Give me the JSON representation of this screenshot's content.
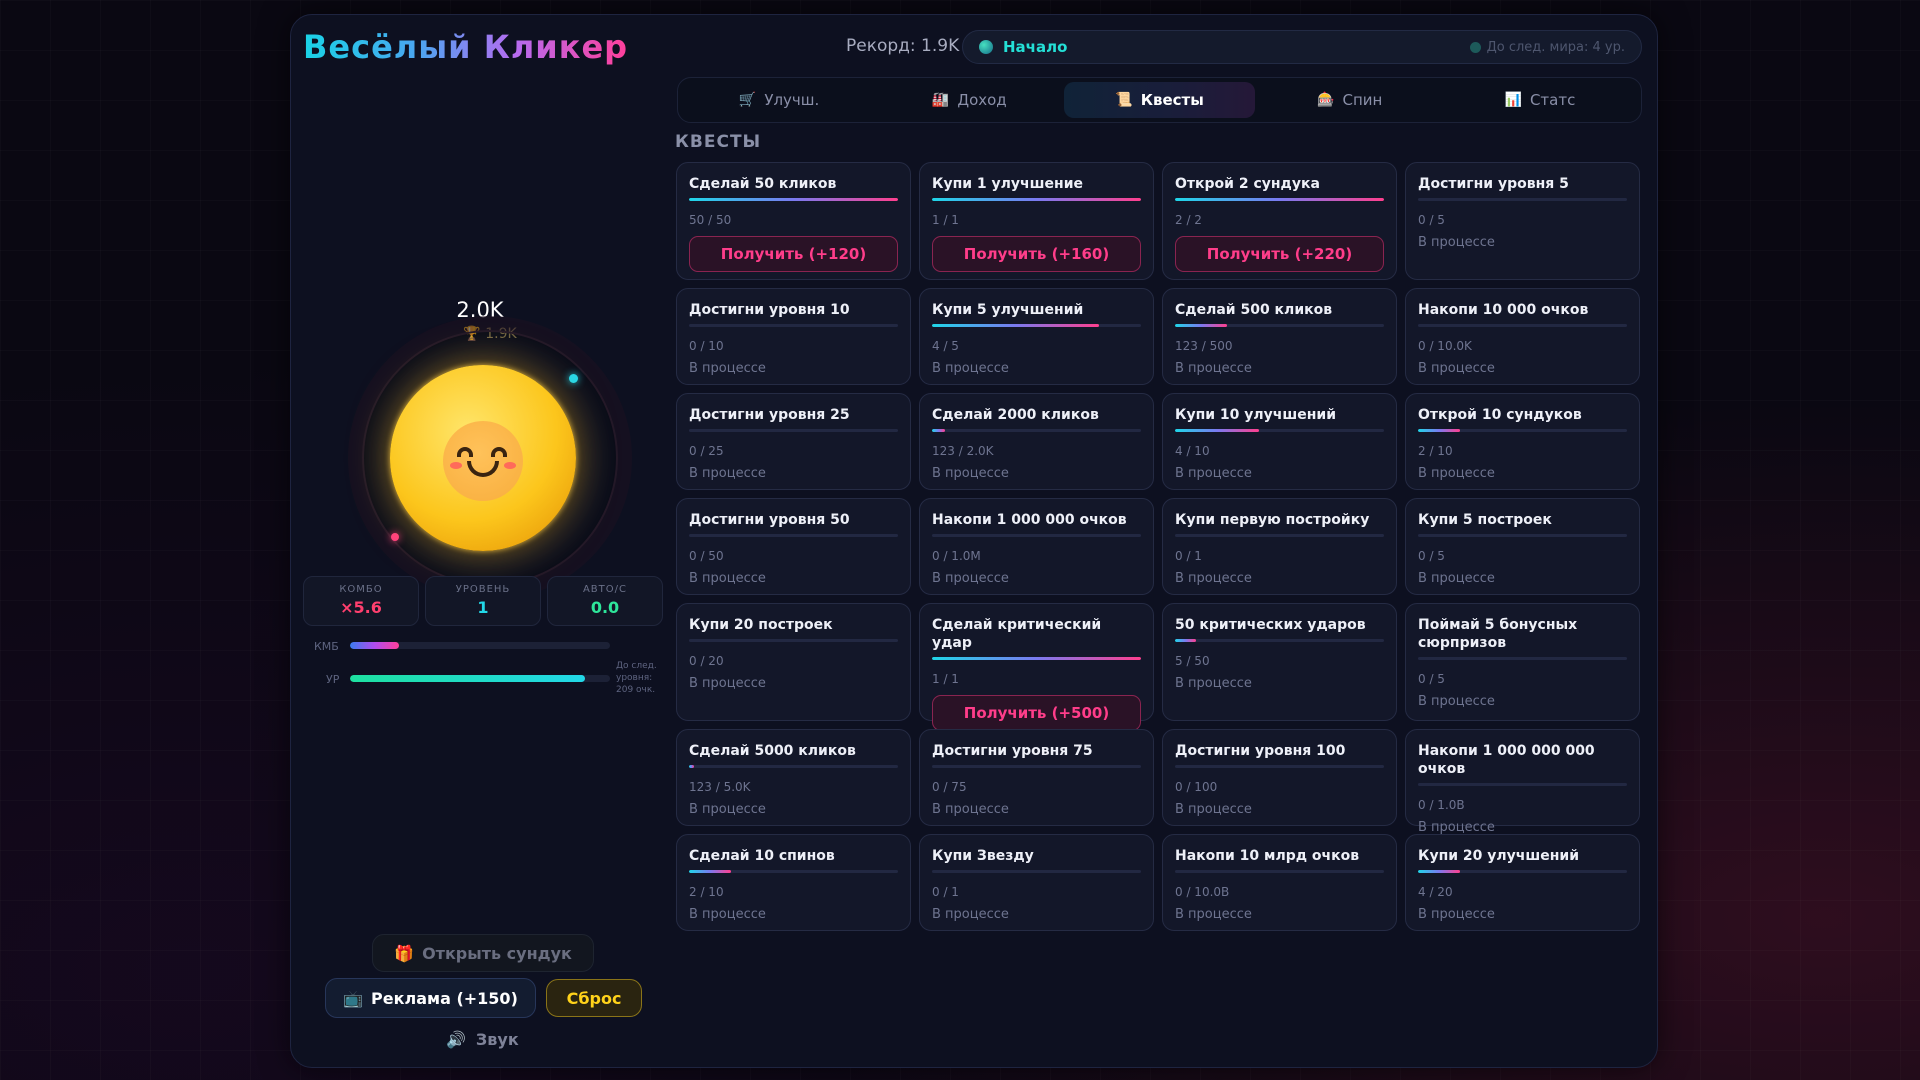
{
  "header": {
    "title": "Весёлый Кликер",
    "record": "Рекорд: 1.9K",
    "world_name": "Начало",
    "world_next": "До след. мира: 4 ур."
  },
  "tabs": [
    {
      "icon": "🛒",
      "label": "Улучш."
    },
    {
      "icon": "🏭",
      "label": "Доход"
    },
    {
      "icon": "📜",
      "label": "Квесты"
    },
    {
      "icon": "🎰",
      "label": "Спин"
    },
    {
      "icon": "📊",
      "label": "Статс"
    }
  ],
  "active_tab": "Квесты",
  "section_label": "КВЕСТЫ",
  "player": {
    "score": "2.0K",
    "best": "1.9K",
    "stats": [
      {
        "label": "КОМБО",
        "value": "×5.6",
        "color": "#ff3f6e"
      },
      {
        "label": "УРОВЕНЬ",
        "value": "1",
        "color": "#22d8e8"
      },
      {
        "label": "АВТО/С",
        "value": "0.0",
        "color": "#2ee59a"
      }
    ],
    "combo_label": "КМБ",
    "combo_fraction": 0.19,
    "level_label": "УР",
    "level_fraction": 0.905,
    "level_hint": "До след. уровня: 209 очк."
  },
  "buttons": {
    "chest": "Открыть сундук",
    "ad": "Реклама (+150)",
    "reset": "Сброс",
    "sound": "Звук"
  },
  "quests": [
    {
      "title": "Сделай 50 кликов",
      "progress": "50 / 50",
      "fraction": 1.0,
      "claim": "Получить (+120)"
    },
    {
      "title": "Купи 1 улучшение",
      "progress": "1 / 1",
      "fraction": 1.0,
      "claim": "Получить (+160)"
    },
    {
      "title": "Открой 2 сундука",
      "progress": "2 / 2",
      "fraction": 1.0,
      "claim": "Получить (+220)"
    },
    {
      "title": "Достигни уровня 5",
      "progress": "0 / 5",
      "fraction": 0,
      "status": "В процессе"
    },
    {
      "title": "Достигни уровня 10",
      "progress": "0 / 10",
      "fraction": 0,
      "status": "В процессе"
    },
    {
      "title": "Купи 5 улучшений",
      "progress": "4 / 5",
      "fraction": 0.8,
      "status": "В процессе"
    },
    {
      "title": "Сделай 500 кликов",
      "progress": "123 / 500",
      "fraction": 0.25,
      "status": "В процессе"
    },
    {
      "title": "Накопи 10 000 очков",
      "progress": "0 / 10.0K",
      "fraction": 0,
      "status": "В процессе"
    },
    {
      "title": "Достигни уровня 25",
      "progress": "0 / 25",
      "fraction": 0,
      "status": "В процессе"
    },
    {
      "title": "Сделай 2000 кликов",
      "progress": "123 / 2.0K",
      "fraction": 0.06,
      "status": "В процессе"
    },
    {
      "title": "Купи 10 улучшений",
      "progress": "4 / 10",
      "fraction": 0.4,
      "status": "В процессе"
    },
    {
      "title": "Открой 10 сундуков",
      "progress": "2 / 10",
      "fraction": 0.2,
      "status": "В процессе"
    },
    {
      "title": "Достигни уровня 50",
      "progress": "0 / 50",
      "fraction": 0,
      "status": "В процессе"
    },
    {
      "title": "Накопи 1 000 000 очков",
      "progress": "0 / 1.0M",
      "fraction": 0,
      "status": "В процессе"
    },
    {
      "title": "Купи первую постройку",
      "progress": "0 / 1",
      "fraction": 0,
      "status": "В процессе"
    },
    {
      "title": "Купи 5 построек",
      "progress": "0 / 5",
      "fraction": 0,
      "status": "В процессе"
    },
    {
      "title": "Купи 20 построек",
      "progress": "0 / 20",
      "fraction": 0,
      "status": "В процессе"
    },
    {
      "title": "Сделай критический удар",
      "progress": "1 / 1",
      "fraction": 1.0,
      "claim": "Получить (+500)"
    },
    {
      "title": "50 критических ударов",
      "progress": "5 / 50",
      "fraction": 0.1,
      "status": "В процессе"
    },
    {
      "title": "Поймай 5 бонусных сюрпризов",
      "progress": "0 / 5",
      "fraction": 0,
      "status": "В процессе"
    },
    {
      "title": "Сделай 5000 кликов",
      "progress": "123 / 5.0K",
      "fraction": 0.025,
      "status": "В процессе"
    },
    {
      "title": "Достигни уровня 75",
      "progress": "0 / 75",
      "fraction": 0,
      "status": "В процессе"
    },
    {
      "title": "Достигни уровня 100",
      "progress": "0 / 100",
      "fraction": 0,
      "status": "В процессе"
    },
    {
      "title": "Накопи 1 000 000 000 очков",
      "progress": "0 / 1.0B",
      "fraction": 0,
      "status": "В процессе"
    },
    {
      "title": "Сделай 10 спинов",
      "progress": "2 / 10",
      "fraction": 0.2,
      "status": "В процессе"
    },
    {
      "title": "Купи Звезду",
      "progress": "0 / 1",
      "fraction": 0,
      "status": "В процессе"
    },
    {
      "title": "Накопи 10 млрд очков",
      "progress": "0 / 10.0B",
      "fraction": 0,
      "status": "В процессе"
    },
    {
      "title": "Купи 20 улучшений",
      "progress": "4 / 20",
      "fraction": 0.2,
      "status": "В процессе"
    }
  ]
}
